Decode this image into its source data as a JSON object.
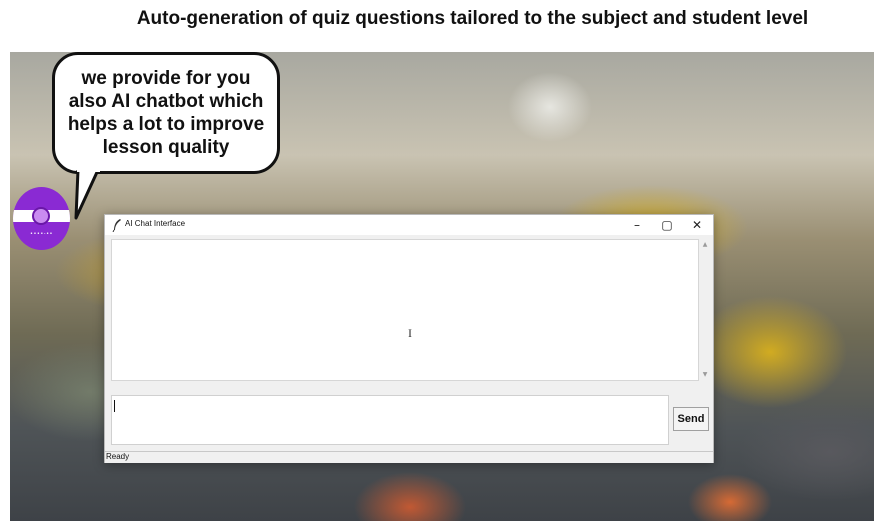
{
  "slide": {
    "title": "Auto-generation of quiz questions tailored to the subject and student level",
    "speech_bubble": "we provide for you also AI chatbot which helps a lot to improve lesson quality",
    "logo_text": "••••-••"
  },
  "window": {
    "title": "AI Chat Interface",
    "controls": {
      "minimize": "–",
      "maximize": "▢",
      "close": "✕"
    },
    "icon": "feather-icon"
  },
  "chat": {
    "messages": [],
    "input_value": "",
    "send_label": "Send"
  },
  "status": {
    "text": "Ready"
  },
  "colors": {
    "logo_purple": "#8a2ad3",
    "window_bg": "#f0f0f0"
  }
}
